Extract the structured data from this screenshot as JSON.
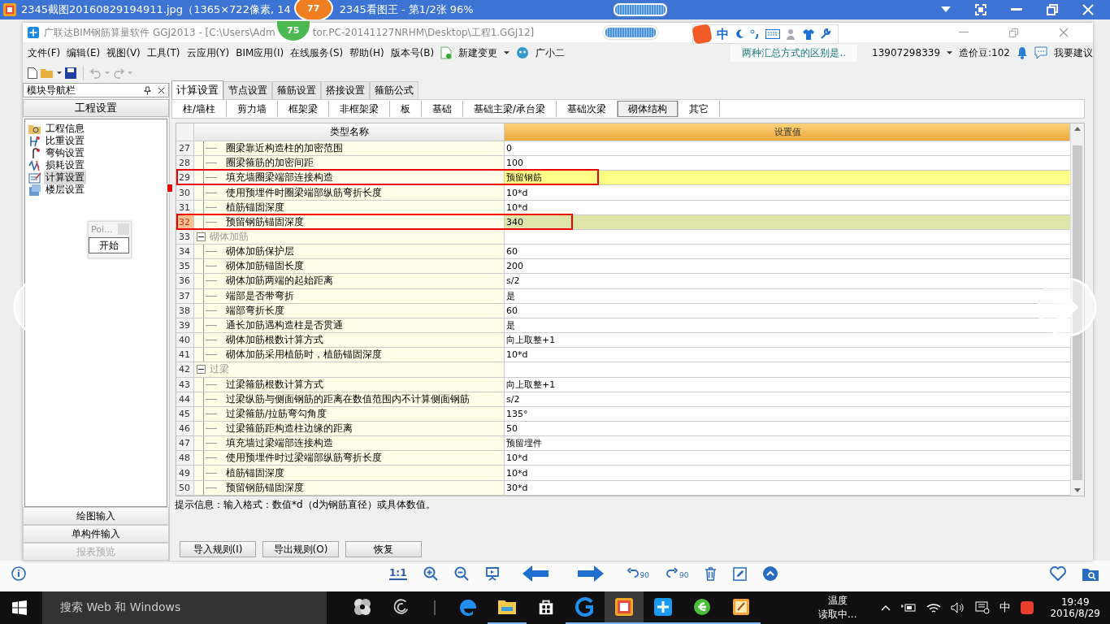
{
  "viewer": {
    "title": "2345截图20160829194911.jpg（1365×722像素, 14",
    "title_2": "2345看图王 - 第1/2张 96%",
    "badge": "77"
  },
  "app": {
    "title": "广联达BIM钢筋算量软件 GGJ2013 - [C:\\Users\\Adm",
    "title_2": "tor.PC-20141127NRHM\\Desktop\\工程1.GGJ12]",
    "badge": "75"
  },
  "menu": [
    "文件(F)",
    "编辑(E)",
    "视图(V)",
    "工具(T)",
    "云应用(Y)",
    "BIM应用(I)",
    "在线服务(S)",
    "帮助(H)",
    "版本号(B)"
  ],
  "menu_extras": [
    {
      "kind": "change",
      "label": "新建变更"
    },
    {
      "kind": "helper",
      "label": "广小二"
    }
  ],
  "ime_bar": {
    "label": "中"
  },
  "notice": "两种汇总方式的区别是..",
  "account": "13907298339",
  "beans": "造价豆:102",
  "suggest": "我要建议",
  "toolbar": [
    {
      "kind": "new",
      "disabled": false
    },
    {
      "kind": "open",
      "disabled": false
    },
    {
      "kind": "save",
      "disabled": false
    },
    {
      "kind": "undo",
      "disabled": true
    },
    {
      "kind": "redo",
      "disabled": true
    }
  ],
  "nav": {
    "title": "模块导航栏",
    "section": "工程设置",
    "items": [
      {
        "label": "工程信息",
        "kind": "info",
        "selected": false
      },
      {
        "label": "比重设置",
        "kind": "weight",
        "selected": false
      },
      {
        "label": "弯钩设置",
        "kind": "hook",
        "selected": false
      },
      {
        "label": "损耗设置",
        "kind": "loss",
        "selected": false
      },
      {
        "label": "计算设置",
        "kind": "calc",
        "selected": true
      },
      {
        "label": "楼层设置",
        "kind": "floor",
        "selected": false
      }
    ],
    "bottom": [
      {
        "label": "绘图输入",
        "disabled": false
      },
      {
        "label": "单构件输入",
        "disabled": false
      },
      {
        "label": "报表预览",
        "disabled": true
      }
    ]
  },
  "popup": {
    "title": "Poi...",
    "button": "开始"
  },
  "tabs": [
    {
      "label": "计算设置",
      "selected": true
    },
    {
      "label": "节点设置",
      "selected": false
    },
    {
      "label": "箍筋设置",
      "selected": false
    },
    {
      "label": "搭接设置",
      "selected": false
    },
    {
      "label": "箍筋公式",
      "selected": false
    }
  ],
  "subtabs": [
    {
      "label": "柱/墙柱",
      "selected": false
    },
    {
      "label": "剪力墙",
      "selected": false
    },
    {
      "label": "框架梁",
      "selected": false
    },
    {
      "label": "非框架梁",
      "selected": false
    },
    {
      "label": "板",
      "selected": false
    },
    {
      "label": "基础",
      "selected": false
    },
    {
      "label": "基础主梁/承台梁",
      "selected": false
    },
    {
      "label": "基础次梁",
      "selected": false
    },
    {
      "label": "砌体结构",
      "selected": true
    },
    {
      "label": "其它",
      "selected": false
    }
  ],
  "table": {
    "columns": [
      "类型名称",
      "设置值"
    ],
    "rows": [
      {
        "num": "27",
        "name": "圈梁靠近构造柱的加密范围",
        "value": "0",
        "selected": false,
        "annotated": false
      },
      {
        "num": "28",
        "name": "圈梁箍筋的加密间距",
        "value": "100",
        "selected": false,
        "annotated": false
      },
      {
        "num": "29",
        "name": "填充墙圈梁端部连接构造",
        "value": "预留钢筋",
        "selected": false,
        "annotated": true
      },
      {
        "num": "30",
        "name": "使用预埋件时圈梁端部纵筋弯折长度",
        "value": "10*d",
        "selected": false,
        "annotated": false
      },
      {
        "num": "31",
        "name": "植筋锚固深度",
        "value": "10*d",
        "selected": false,
        "annotated": false
      },
      {
        "num": "32",
        "name": "预留钢筋锚固深度",
        "value": "340",
        "selected": true,
        "annotated": true
      },
      {
        "num": "33",
        "name": "砌体加筋",
        "expanded": true,
        "selected": false,
        "annotated": false,
        "children": [
          {
            "num": "34",
            "name": "砌体加筋保护层",
            "value": "60",
            "selected": false,
            "annotated": false
          },
          {
            "num": "35",
            "name": "砌体加筋锚固长度",
            "value": "200",
            "selected": false,
            "annotated": false
          },
          {
            "num": "36",
            "name": "砌体加筋两端的起始距离",
            "value": "s/2",
            "selected": false,
            "annotated": false
          },
          {
            "num": "37",
            "name": "端部是否带弯折",
            "value": "是",
            "selected": false,
            "annotated": false
          },
          {
            "num": "38",
            "name": "端部弯折长度",
            "value": "60",
            "selected": false,
            "annotated": false
          },
          {
            "num": "39",
            "name": "通长加筋遇构造柱是否贯通",
            "value": "是",
            "selected": false,
            "annotated": false
          },
          {
            "num": "40",
            "name": "砌体加筋根数计算方式",
            "value": "向上取整+1",
            "selected": false,
            "annotated": false
          },
          {
            "num": "41",
            "name": "砌体加筋采用植筋时，植筋锚固深度",
            "value": "10*d",
            "selected": false,
            "annotated": false
          }
        ]
      },
      {
        "num": "42",
        "name": "过梁",
        "expanded": true,
        "selected": false,
        "annotated": false,
        "children": [
          {
            "num": "43",
            "name": "过梁箍筋根数计算方式",
            "value": "向上取整+1",
            "selected": false,
            "annotated": false
          },
          {
            "num": "44",
            "name": "过梁纵筋与侧面钢筋的距离在数值范围内不计算侧面钢筋",
            "value": "s/2",
            "selected": false,
            "annotated": false
          },
          {
            "num": "45",
            "name": "过梁箍筋/拉筋弯勾角度",
            "value": "135°",
            "selected": false,
            "annotated": false
          },
          {
            "num": "46",
            "name": "过梁箍筋距构造柱边缘的距离",
            "value": "50",
            "selected": false,
            "annotated": false
          },
          {
            "num": "47",
            "name": "填充墙过梁端部连接构造",
            "value": "预留埋件",
            "selected": false,
            "annotated": false
          },
          {
            "num": "48",
            "name": "使用预埋件时过梁端部纵筋弯折长度",
            "value": "10*d",
            "selected": false,
            "annotated": false
          },
          {
            "num": "49",
            "name": "植筋锚固深度",
            "value": "10*d",
            "selected": false,
            "annotated": false
          },
          {
            "num": "50",
            "name": "预留钢筋锚固深度",
            "value": "30*d",
            "selected": false,
            "annotated": false
          }
        ]
      }
    ]
  },
  "hint": "提示信息：输入格式：数值*d（d为钢筋直径）或具体数值。",
  "buttons": [
    "导入规则(I)",
    "导出规则(O)",
    "恢复"
  ],
  "viewer_toolbar": [
    {
      "kind": "ratio",
      "label": "1:1"
    },
    {
      "kind": "zoom-in"
    },
    {
      "kind": "zoom-out"
    },
    {
      "kind": "slideshow"
    },
    {
      "kind": "prev"
    },
    {
      "kind": "next"
    },
    {
      "kind": "rotate-left",
      "label": "90"
    },
    {
      "kind": "rotate-right",
      "label": "90"
    },
    {
      "kind": "delete"
    },
    {
      "kind": "edit"
    },
    {
      "kind": "up"
    }
  ],
  "taskbar": {
    "search": "搜索 Web 和 Windows",
    "apps": [
      {
        "kind": "pinwheel",
        "running": false,
        "selected": false
      },
      {
        "kind": "swirl",
        "running": false,
        "selected": false
      },
      {
        "kind": "edge",
        "running": false,
        "selected": false
      },
      {
        "kind": "explorer",
        "running": true,
        "selected": false
      },
      {
        "kind": "store",
        "running": false,
        "selected": false
      },
      {
        "kind": "g-app",
        "running": true,
        "selected": false
      },
      {
        "kind": "viewer",
        "running": true,
        "selected": true
      },
      {
        "kind": "plus-app",
        "running": true,
        "selected": false
      },
      {
        "kind": "browser",
        "running": true,
        "selected": false
      },
      {
        "kind": "notes",
        "running": true,
        "selected": false
      }
    ],
    "weather": [
      "温度",
      "读取中..."
    ],
    "ime": "中",
    "time": "19:49",
    "date": "2016/8/29"
  }
}
